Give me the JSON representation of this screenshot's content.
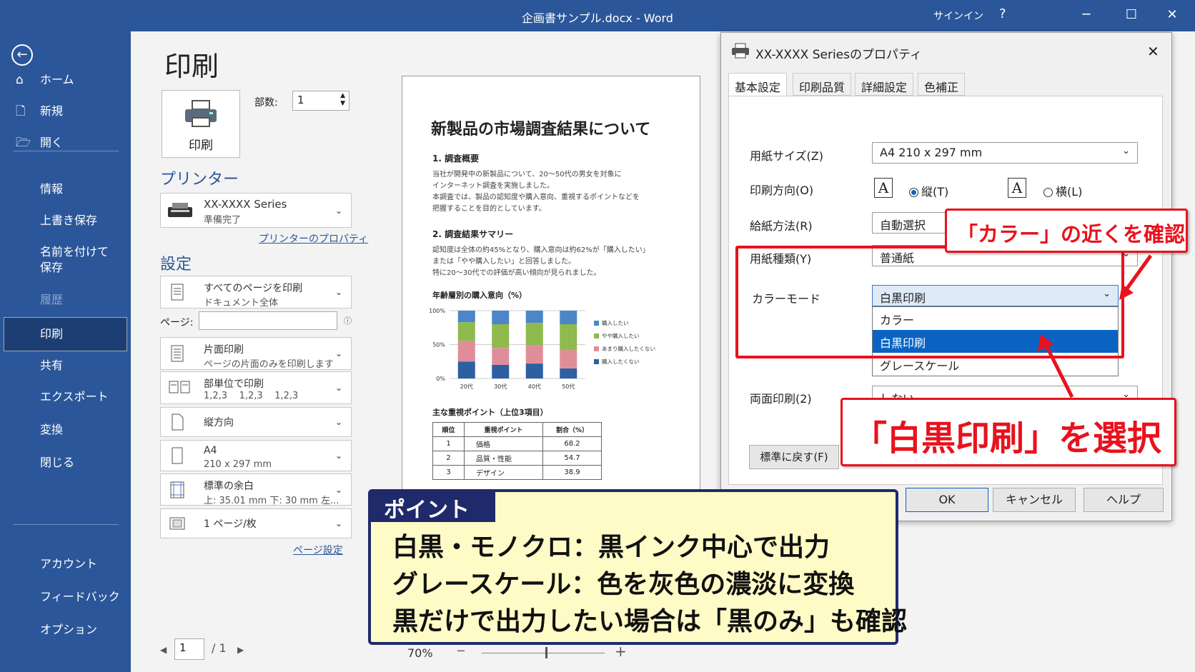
{
  "window": {
    "title": "企画書サンプル.docx  -  Word",
    "signin": "サインイン",
    "help": "?",
    "minimize": "─",
    "maximize": "☐",
    "close": "✕"
  },
  "sidebar": {
    "back": "←",
    "items": [
      {
        "label": "ホーム",
        "icon": "⌂"
      },
      {
        "label": "新規",
        "icon": "🗋"
      },
      {
        "label": "開く",
        "icon": "🗁"
      },
      {
        "label": "情報"
      },
      {
        "label": "上書き保存"
      },
      {
        "label": "名前を付けて"
      },
      {
        "label": "保存"
      },
      {
        "label": "履歴"
      },
      {
        "label": "印刷"
      },
      {
        "label": "共有"
      },
      {
        "label": "エクスポート"
      },
      {
        "label": "変換"
      },
      {
        "label": "閉じる"
      },
      {
        "label": "アカウント"
      },
      {
        "label": "フィードバック"
      },
      {
        "label": "オプション"
      }
    ]
  },
  "print": {
    "heading": "印刷",
    "button": "印刷",
    "copies_label": "部数:",
    "copies_value": "1",
    "printer_heading": "プリンター",
    "printer_name": "XX-XXXX Series",
    "printer_status": "準備完了",
    "printer_props_link": "プリンターのプロパティ",
    "settings_heading": "設定",
    "opt_pages_1": "すべてのページを印刷",
    "opt_pages_2": "ドキュメント全体",
    "page_label": "ページ:",
    "opt_sides_1": "片面印刷",
    "opt_sides_2": "ページの片面のみを印刷します",
    "opt_collate_1": "部単位で印刷",
    "opt_collate_2": "1,2,3    1,2,3    1,2,3",
    "opt_orient": "縦方向",
    "opt_paper_1": "A4",
    "opt_paper_2": "210 x 297 mm",
    "opt_margin_1": "標準の余白",
    "opt_margin_2": "上: 35.01 mm 下: 30 mm 左...",
    "opt_pps": "1 ページ/枚",
    "page_setup_link": "ページ設定",
    "page_current": "1",
    "page_total": "/ 1",
    "zoom": "70%",
    "zoom_minus": "─",
    "zoom_plus": "+"
  },
  "preview": {
    "title": "新製品の市場調査結果について",
    "s1": "1. 調査概要",
    "p1": "当社が開発中の新製品について、20～50代の男女を対象に\nインターネット調査を実施しました。\n本調査では、製品の認知度や購入意向、重視するポイントなどを\n把握することを目的としています。",
    "s2": "2. 調査結果サマリー",
    "p2": "認知度は全体の約45%となり、購入意向は約62%が「購入したい」\nまたは「やや購入したい」と回答しました。\n特に20～30代での評価が高い傾向が見られました。",
    "chart_title": "年齢層別の購入意向（%）",
    "table_title": "主な重視ポイント（上位3項目）",
    "table_headers": [
      "順位",
      "重視ポイント",
      "割合（%）"
    ],
    "table_rows": [
      [
        "1",
        "価格",
        "68.2"
      ],
      [
        "2",
        "品質・性能",
        "54.7"
      ],
      [
        "3",
        "デザイン",
        "38.9"
      ]
    ]
  },
  "chart_data": {
    "type": "bar",
    "title": "年齢層別の購入意向（%）",
    "categories": [
      "20代",
      "30代",
      "40代",
      "50代"
    ],
    "ytick_labels": [
      "100%",
      "50%",
      "0%"
    ],
    "ylim": [
      0,
      100
    ],
    "stacked": true,
    "series": [
      {
        "name": "購入したくない",
        "color": "#2e5fa3",
        "values": [
          25,
          20,
          22,
          15
        ]
      },
      {
        "name": "あまり購入したくない",
        "color": "#e08d9a",
        "values": [
          30,
          25,
          27,
          27
        ]
      },
      {
        "name": "やや購入したい",
        "color": "#8fba4e",
        "values": [
          28,
          35,
          33,
          38
        ]
      },
      {
        "name": "購入したい",
        "color": "#4a86c8",
        "values": [
          17,
          20,
          18,
          20
        ]
      }
    ],
    "legend_order": [
      "購入したい",
      "やや購入したい",
      "あまり購入したくない",
      "購入したくない"
    ],
    "legend_position": "right"
  },
  "dialog": {
    "title": "XX-XXXX Seriesのプロパティ",
    "close": "✕",
    "tabs": [
      "基本設定",
      "印刷品質",
      "詳細設定",
      "色補正"
    ],
    "paper_size_label": "用紙サイズ(Z)",
    "paper_size_value": "A4 210 x 297 mm",
    "orientation_label": "印刷方向(O)",
    "portrait": "縦(T)",
    "landscape": "横(L)",
    "feed_label": "給紙方法(R)",
    "feed_value": "自動選択",
    "paper_type_label": "用紙種類(Y)",
    "paper_type_value": "普通紙",
    "color_mode_label": "カラーモード",
    "color_mode_value": "白黒印刷",
    "color_options": [
      "カラー",
      "白黒印刷",
      "グレースケール"
    ],
    "duplex_label": "両面印刷(2)",
    "duplex_value": "しない",
    "reset_button": "標準に戻す(F)",
    "ok": "OK",
    "cancel": "キャンセル",
    "help": "ヘルプ"
  },
  "annotations": {
    "callout_top": "「カラー」の近くを確認",
    "callout_bottom": "「白黒印刷」を選択",
    "point_tag": "ポイント",
    "point_lines": [
      "白黒・モノクロ：黒インク中心で出力",
      "グレースケール：色を灰色の濃淡に変換",
      "黒だけで出力したい場合は「黒のみ」も確認"
    ],
    "accent": "#e8121d",
    "navy": "#1f2a6b"
  }
}
